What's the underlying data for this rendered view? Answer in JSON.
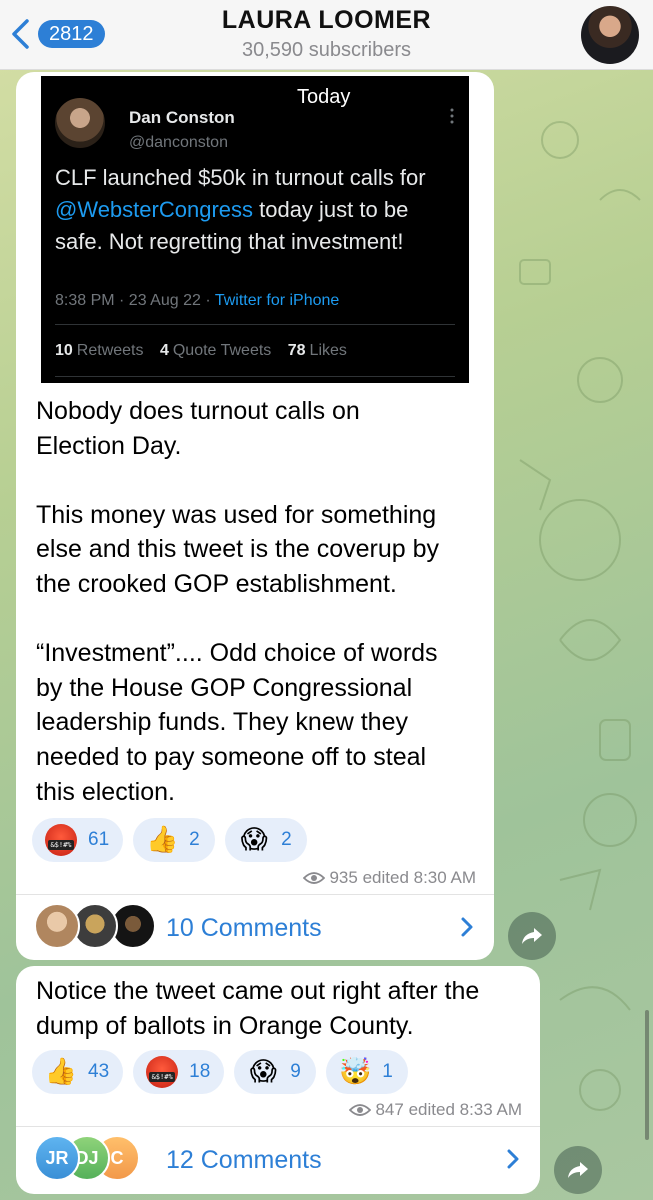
{
  "header": {
    "back_badge": "2812",
    "title": "LAURA LOOMER",
    "subscribers": "30,590 subscribers"
  },
  "post1": {
    "tweet": {
      "today_label": "Today",
      "author_name": "Dan Conston",
      "author_handle": "@danconston",
      "text_before": "CLF launched $50k in turnout calls for ",
      "mention": "@WebsterCongress",
      "text_after": " today just to be safe. Not regretting that investment!",
      "time_date": "8:38 PM · 23 Aug 22 · ",
      "source": "Twitter for iPhone",
      "retweets_count": "10",
      "retweets_label": "Retweets",
      "quotes_count": "4",
      "quotes_label": "Quote Tweets",
      "likes_count": "78",
      "likes_label": "Likes"
    },
    "text": "Nobody does turnout calls on\nElection Day.\n\nThis money was used for something\nelse and this tweet is the coverup by\nthe crooked GOP establishment.\n\n“Investment”.... Odd choice of words\nby the House GOP Congressional\nleadership funds. They knew they\nneeded to pay someone off to steal\nthis election.",
    "reactions": [
      {
        "icon": "cursing-face-icon",
        "emoji": "",
        "count": "61"
      },
      {
        "icon": "thumbs-up-icon",
        "emoji": "👍",
        "count": "2"
      },
      {
        "icon": "screaming-face-icon",
        "emoji": "😱",
        "count": "2"
      }
    ],
    "views": "935",
    "edited": "edited 8:30 AM",
    "comments_label": "10 Comments"
  },
  "post2": {
    "text": "Notice the tweet came out right after the\ndump of ballots in Orange County.",
    "reactions": [
      {
        "icon": "thumbs-up-icon",
        "emoji": "👍",
        "count": "43"
      },
      {
        "icon": "cursing-face-icon",
        "emoji": "",
        "count": "18"
      },
      {
        "icon": "screaming-face-icon",
        "emoji": "😱",
        "count": "9"
      },
      {
        "icon": "exploding-head-icon",
        "emoji": "🤯",
        "count": "1"
      }
    ],
    "views": "847",
    "edited": "edited 8:33 AM",
    "comments_label": "12 Comments",
    "commenter_initials": [
      "JR",
      "DJ",
      "C"
    ]
  },
  "colors": {
    "accent": "#2d7fd6",
    "reaction_bg": "#e6eefa",
    "tweet_link": "#1d9bf0"
  }
}
